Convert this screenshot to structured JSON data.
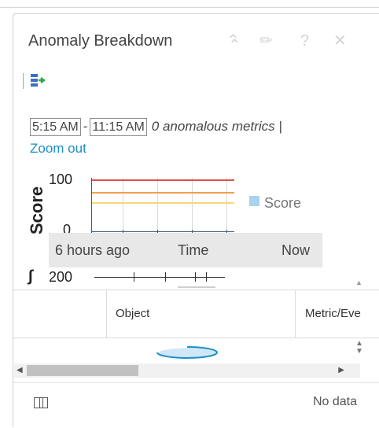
{
  "widget": {
    "title": "Anomaly Breakdown",
    "header_icons": {
      "collapse": "double-chevron-up-icon",
      "edit": "pencil-icon",
      "help": "help-icon",
      "close": "close-icon"
    }
  },
  "toolbar": {
    "export_icon": "export-icon"
  },
  "time_range": {
    "start": "5:15 AM",
    "separator": "-",
    "end": "11:15 AM",
    "anomalous_text": "0 anomalous metrics |",
    "zoom_out": "Zoom out"
  },
  "chart_data": {
    "type": "line",
    "ylabel": "Score",
    "ylim": [
      0,
      100
    ],
    "yticks": [
      "100",
      "0"
    ],
    "legend": [
      "Score"
    ],
    "legend_placement": "right",
    "threshold_colors": [
      "#d9534f",
      "#f0a04b",
      "#f7d774"
    ],
    "series_color": "#a9d3ee",
    "x_start_label": "6 hours ago",
    "x_axis_label": "Time",
    "x_end_label": "Now"
  },
  "mini_chart": {
    "tick_label": "200"
  },
  "grid": {
    "columns": [
      {
        "label": ""
      },
      {
        "label": "Object"
      },
      {
        "label": "Metric/Eve"
      }
    ]
  },
  "footer": {
    "status": "No data",
    "column_icon": "columns-icon"
  }
}
